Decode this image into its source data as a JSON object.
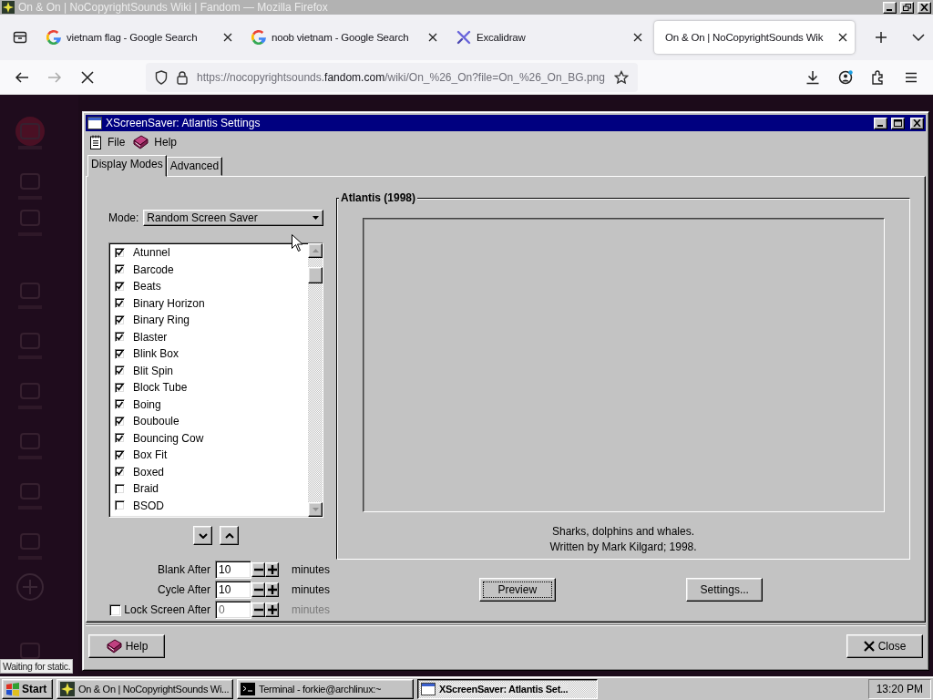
{
  "browser_window": {
    "title": "On & On | NoCopyrightSounds Wiki | Fandom — Mozilla Firefox"
  },
  "tabs": [
    {
      "label": "vietnam flag - Google Search",
      "kind": "google",
      "selected": false
    },
    {
      "label": "noob vietnam - Google Search",
      "kind": "google",
      "selected": false
    },
    {
      "label": "Excalidraw",
      "kind": "excalidraw",
      "selected": false
    },
    {
      "label": "On & On | NoCopyrightSounds Wik",
      "kind": "blank",
      "selected": true
    }
  ],
  "address_bar": {
    "url_prefix": "https://nocopyrightsounds.",
    "url_domain": "fandom.com",
    "url_path": "/wiki/On_%26_On?file=On_%26_On_BG.png"
  },
  "status_text": "Waiting for static.",
  "dialog": {
    "title": "XScreenSaver: Atlantis Settings",
    "menu": [
      "File",
      "Help"
    ],
    "tabs": [
      {
        "label": "Display Modes",
        "selected": true
      },
      {
        "label": "Advanced",
        "selected": false
      }
    ],
    "mode_label": "Mode:",
    "mode_value": "Random Screen Saver",
    "savers": [
      {
        "name": "Atunnel",
        "checked": true
      },
      {
        "name": "Barcode",
        "checked": true
      },
      {
        "name": "Beats",
        "checked": true
      },
      {
        "name": "Binary Horizon",
        "checked": true
      },
      {
        "name": "Binary Ring",
        "checked": true
      },
      {
        "name": "Blaster",
        "checked": true
      },
      {
        "name": "Blink Box",
        "checked": true
      },
      {
        "name": "Blit Spin",
        "checked": true
      },
      {
        "name": "Block Tube",
        "checked": true
      },
      {
        "name": "Boing",
        "checked": true
      },
      {
        "name": "Bouboule",
        "checked": true
      },
      {
        "name": "Bouncing Cow",
        "checked": true
      },
      {
        "name": "Box Fit",
        "checked": true
      },
      {
        "name": "Boxed",
        "checked": true
      },
      {
        "name": "Braid",
        "checked": false
      },
      {
        "name": "BSOD",
        "checked": false
      }
    ],
    "timers": [
      {
        "label": "Blank After",
        "value": "10",
        "unit": "minutes"
      },
      {
        "label": "Cycle After",
        "value": "10",
        "unit": "minutes"
      }
    ],
    "lock": {
      "label": "Lock Screen After",
      "checked": false,
      "value": "0",
      "unit": "minutes"
    },
    "preview": {
      "title": "Atlantis (1998)",
      "description": [
        "Sharks, dolphins and whales.",
        "Written by Mark Kilgard; 1998."
      ]
    },
    "preview_button": "Preview",
    "settings_button": "Settings...",
    "help_button": "Help",
    "close_button": "Close"
  },
  "taskbar": {
    "start": "Start",
    "tasks": [
      {
        "label": "On & On | NoCopyrightSounds Wi...",
        "kind": "firefox",
        "selected": false
      },
      {
        "label": "Terminal - forkie@archlinux:~",
        "kind": "terminal",
        "selected": false
      },
      {
        "label": "XScreenSaver: Atlantis Set...",
        "kind": "window",
        "selected": true
      }
    ],
    "clock": "13:20 PM"
  }
}
